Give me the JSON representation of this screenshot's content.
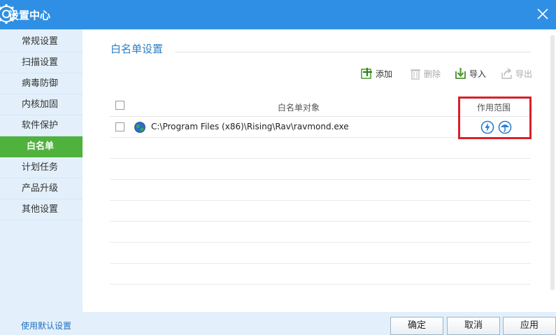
{
  "window": {
    "title": "设置中心"
  },
  "sidebar": {
    "items": [
      {
        "label": "常规设置"
      },
      {
        "label": "扫描设置"
      },
      {
        "label": "病毒防御"
      },
      {
        "label": "内核加固"
      },
      {
        "label": "软件保护"
      },
      {
        "label": "白名单",
        "active": true
      },
      {
        "label": "计划任务"
      },
      {
        "label": "产品升级"
      },
      {
        "label": "其他设置"
      }
    ]
  },
  "main": {
    "section_title": "白名单设置",
    "toolbar": {
      "add_label": "添加",
      "delete_label": "删除",
      "import_label": "导入",
      "export_label": "导出"
    },
    "table": {
      "columns": {
        "object": "白名单对象",
        "scope": "作用范围"
      },
      "rows": [
        {
          "path": "C:\\Program Files (x86)\\Rising\\Rav\\ravmond.exe",
          "scope_icons": [
            "lightning-icon",
            "umbrella-icon"
          ]
        }
      ]
    }
  },
  "footer": {
    "default_link": "使用默认设置",
    "ok_label": "确定",
    "cancel_label": "取消",
    "apply_label": "应用"
  },
  "colors": {
    "titlebar": "#2f8fe4",
    "active_nav": "#4fb23c",
    "accent_text": "#2d7fc7",
    "highlight": "#d8202a"
  }
}
